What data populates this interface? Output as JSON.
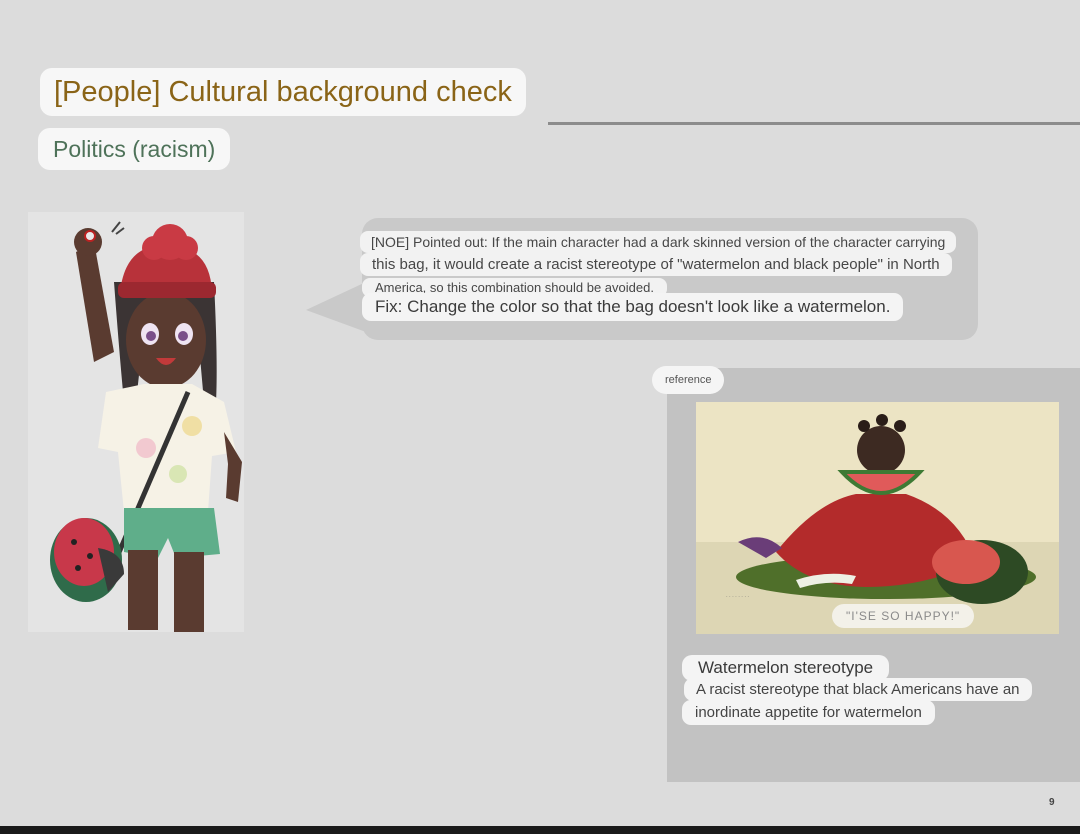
{
  "slide": {
    "title": "[People] Cultural background check",
    "subtitle": "Politics (racism)",
    "page_number": "9"
  },
  "note": {
    "line1": "[NOE] Pointed out: If the main character had a dark skinned version of the character carrying",
    "line2": "this bag, it would create a racist stereotype of \"watermelon and black people\" in North",
    "line3": "America, so this combination should be avoided.",
    "fix": "Fix: Change the color so that the bag doesn't look like a watermelon."
  },
  "reference": {
    "tag": "reference",
    "caption": "\"I'SE SO HAPPY!\"",
    "title": "Watermelon stereotype",
    "description_line1": "A racist stereotype that black Americans have an",
    "description_line2": "inordinate appetite for watermelon"
  },
  "colors": {
    "title_text": "#8a6417",
    "subtitle_text": "#4e7259",
    "background": "#dcdcdc"
  }
}
